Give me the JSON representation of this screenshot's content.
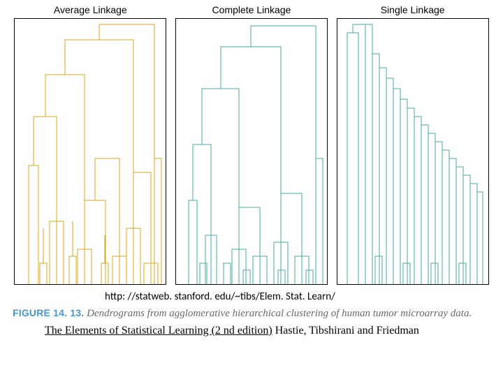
{
  "panels": {
    "p1": {
      "title": "Average Linkage"
    },
    "p2": {
      "title": "Complete Linkage"
    },
    "p3": {
      "title": "Single Linkage"
    }
  },
  "url": "http: //statweb. stanford. edu/~tibs/Elem. Stat. Learn/",
  "caption": {
    "label": "FIGURE 14. 13.",
    "body": "Dendrograms from agglomerative hierarchical clustering of human tumor microarray data."
  },
  "attribution": {
    "title_underlined": "The Elements of Statistical Learning (2 nd edition)",
    "rest": "  Hastie, Tibshirani and Friedman"
  },
  "colors": {
    "avg": "#d4a51f",
    "teal": "#4aa9a3"
  }
}
